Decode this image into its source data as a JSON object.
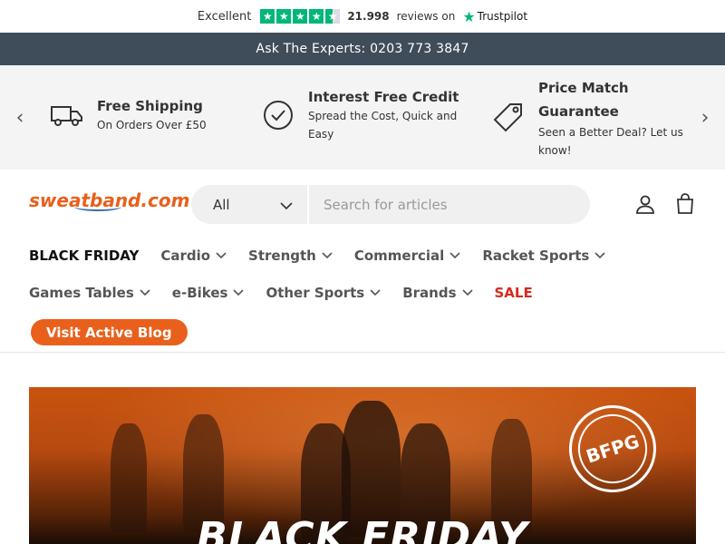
{
  "trustpilot": {
    "rating_label": "Excellent",
    "review_count": "21.998",
    "reviews_text": "reviews on",
    "brand": "Trustpilot",
    "stars": 4.5,
    "accent": "#00b67a"
  },
  "announcement": {
    "text": "Ask The Experts: 0203 773 3847",
    "background": "#3f4c5a"
  },
  "usps": [
    {
      "icon": "truck-icon",
      "title": "Free Shipping",
      "subtitle": "On Orders Over £50"
    },
    {
      "icon": "check-circle-icon",
      "title": "Interest Free Credit",
      "subtitle": "Spread the Cost, Quick and Easy"
    },
    {
      "icon": "price-tag-icon",
      "title": "Price Match Guarantee",
      "subtitle": "Seen a Better Deal? Let us know!"
    }
  ],
  "header": {
    "logo_text": "sweatband.com",
    "search": {
      "category": "All",
      "placeholder": "Search for articles"
    }
  },
  "nav": {
    "row1": [
      {
        "label": "BLACK FRIDAY",
        "dropdown": false
      },
      {
        "label": "Cardio",
        "dropdown": true
      },
      {
        "label": "Strength",
        "dropdown": true
      },
      {
        "label": "Commercial",
        "dropdown": true
      },
      {
        "label": "Racket Sports",
        "dropdown": true
      }
    ],
    "row2": [
      {
        "label": "Games Tables",
        "dropdown": true
      },
      {
        "label": "e-Bikes",
        "dropdown": true
      },
      {
        "label": "Other Sports",
        "dropdown": true
      },
      {
        "label": "Brands",
        "dropdown": true
      },
      {
        "label": "SALE",
        "dropdown": false
      }
    ],
    "blog_button": "Visit Active Blog"
  },
  "hero": {
    "headline": "BLACK FRIDAY",
    "badge_text": "BFPG"
  },
  "colors": {
    "brand_orange": "#e8601c",
    "sale_red": "#d62b1f"
  }
}
